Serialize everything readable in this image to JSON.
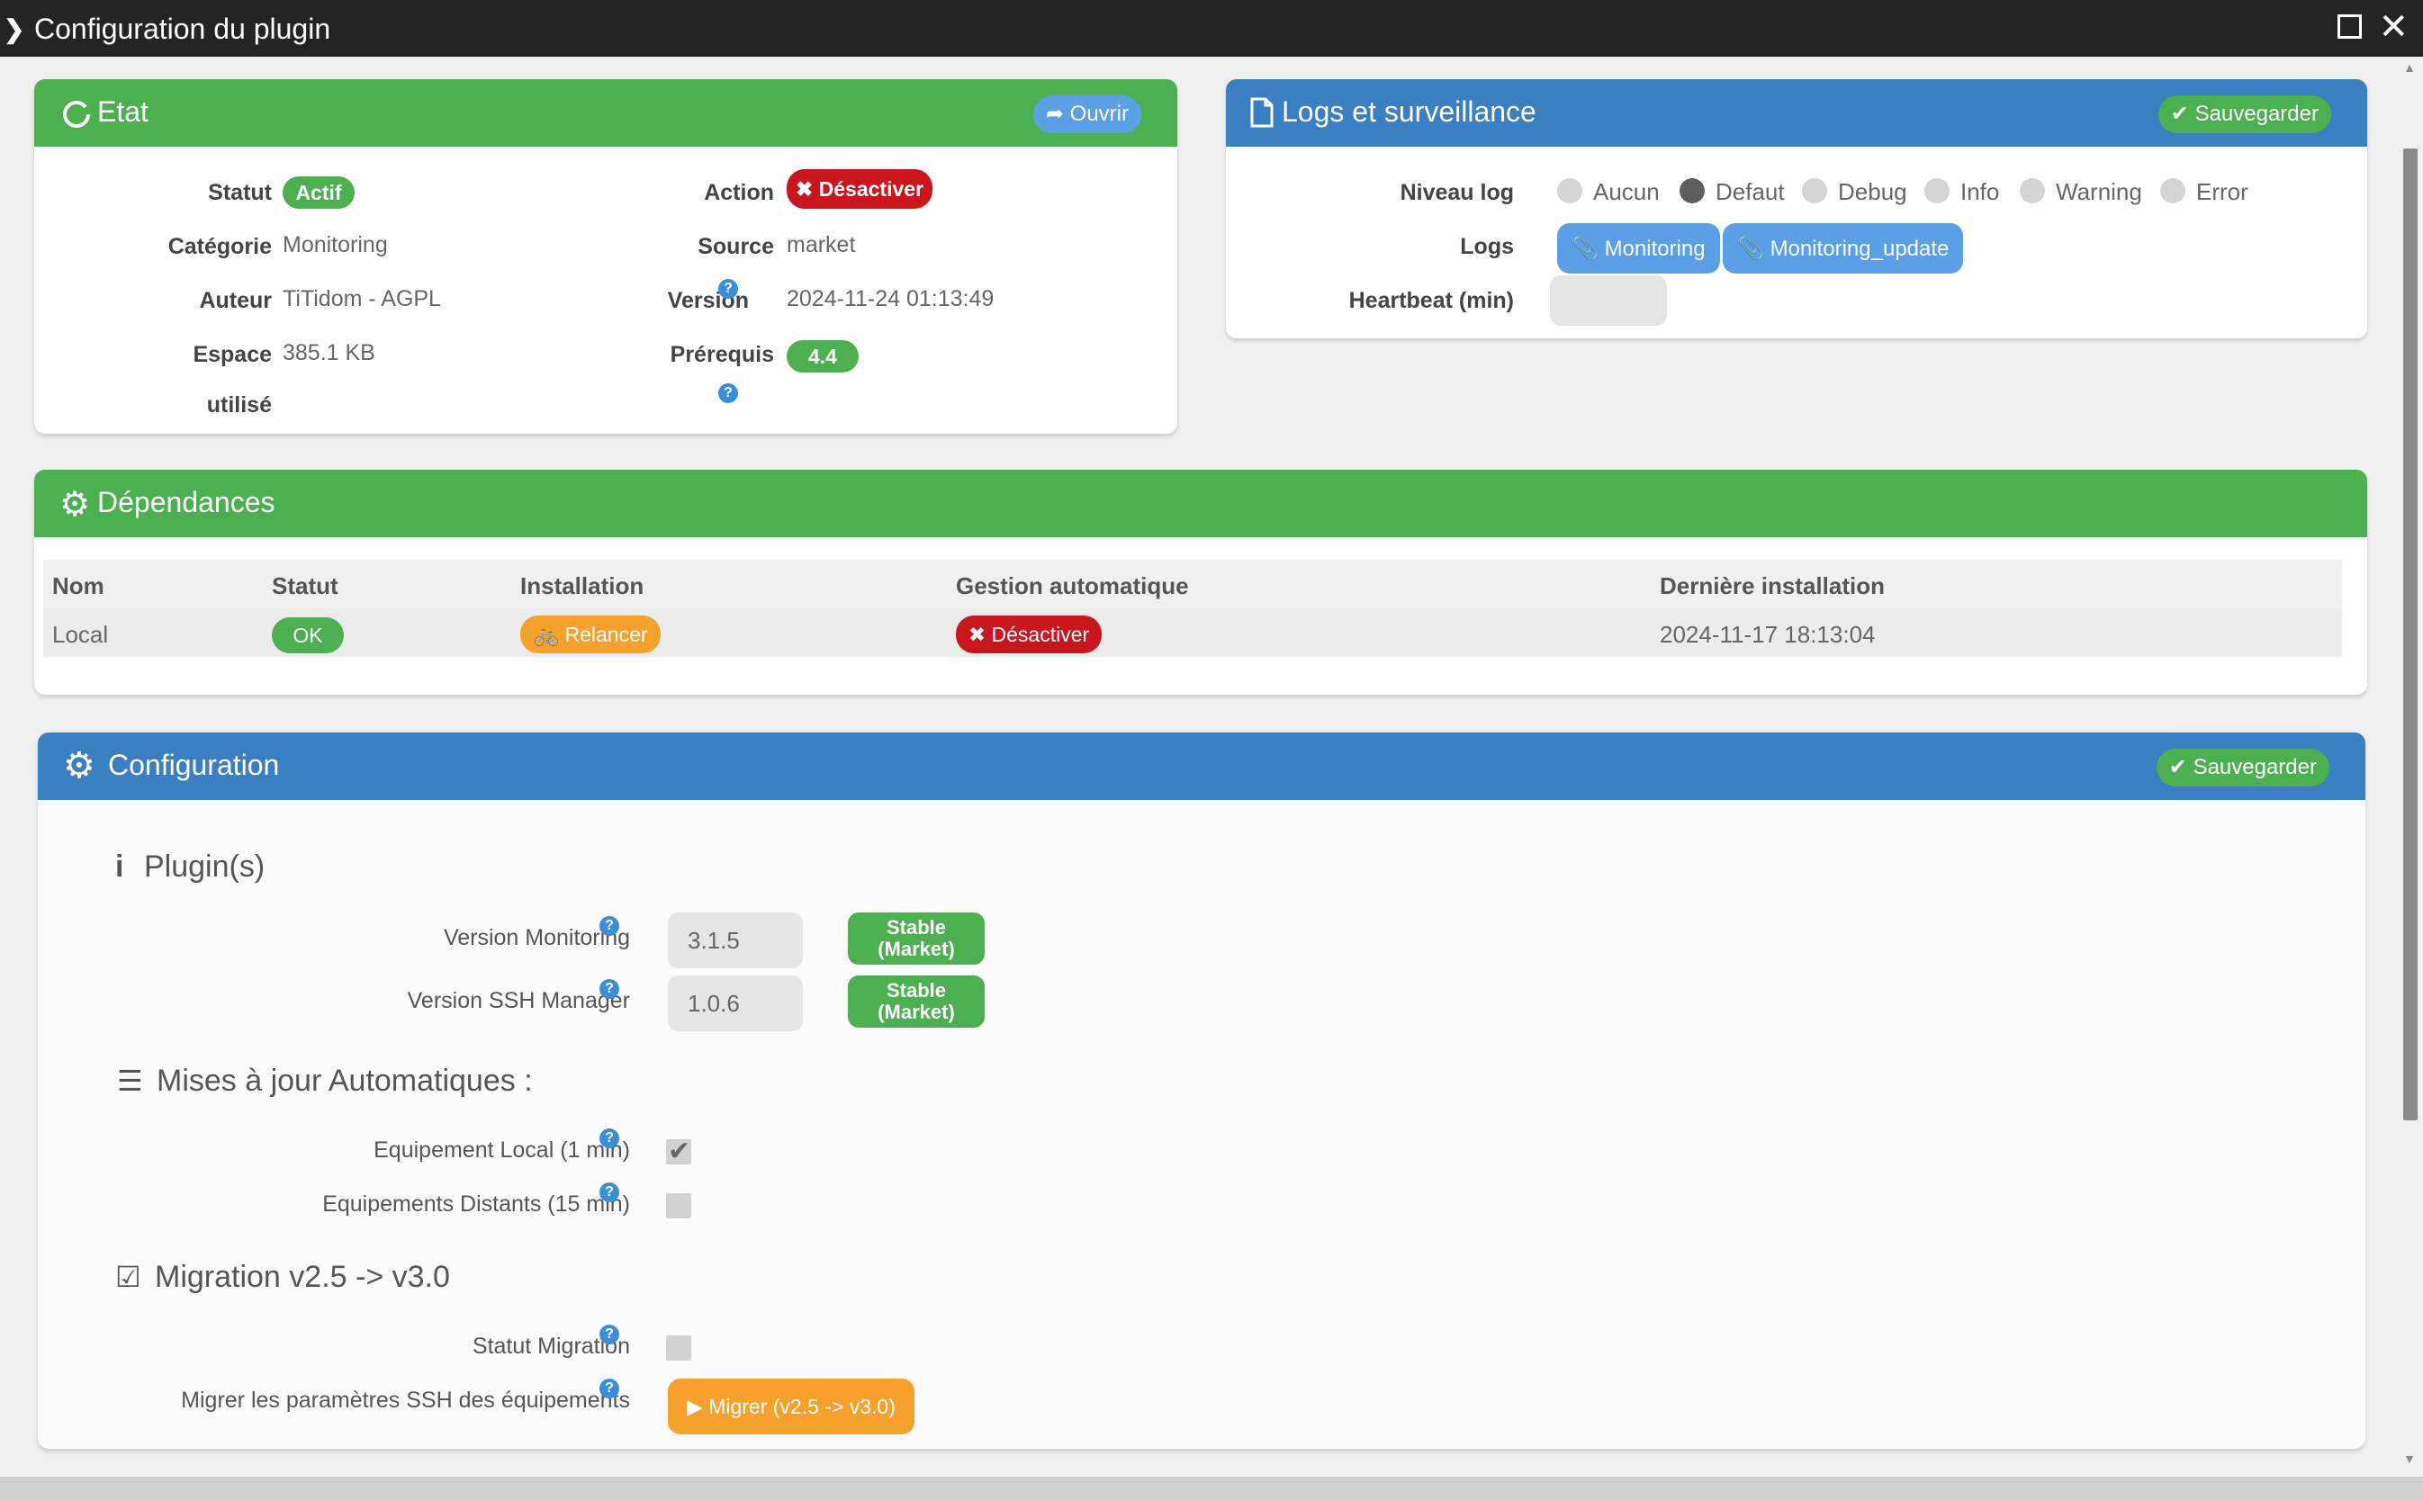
{
  "window": {
    "title": "Configuration du plugin"
  },
  "etat": {
    "title": "Etat",
    "open_label": "Ouvrir",
    "statut_label": "Statut",
    "statut_value": "Actif",
    "categorie_label": "Catégorie",
    "categorie_value": "Monitoring",
    "auteur_label": "Auteur",
    "auteur_value": "TiTidom - AGPL",
    "espace_label_1": "Espace",
    "espace_label_2": "utilisé",
    "espace_value": "385.1 KB",
    "action_label": "Action",
    "action_button": "Désactiver",
    "source_label": "Source",
    "source_value": "market",
    "version_label": "Version",
    "version_value": "2024-11-24 01:13:49",
    "prerequis_label": "Prérequis",
    "prerequis_value": "4.4"
  },
  "logs": {
    "title": "Logs et surveillance",
    "save_label": "Sauvegarder",
    "niveau_label": "Niveau log",
    "levels": [
      {
        "label": "Aucun",
        "selected": false
      },
      {
        "label": "Defaut",
        "selected": true
      },
      {
        "label": "Debug",
        "selected": false
      },
      {
        "label": "Info",
        "selected": false
      },
      {
        "label": "Warning",
        "selected": false
      },
      {
        "label": "Error",
        "selected": false
      }
    ],
    "logs_label": "Logs",
    "log_files": [
      "Monitoring",
      "Monitoring_update"
    ],
    "heartbeat_label": "Heartbeat (min)",
    "heartbeat_value": ""
  },
  "dependances": {
    "title": "Dépendances",
    "columns": [
      "Nom",
      "Statut",
      "Installation",
      "Gestion automatique",
      "Dernière installation"
    ],
    "row": {
      "nom": "Local",
      "statut": "OK",
      "installation": "Relancer",
      "gestion": "Désactiver",
      "derniere": "2024-11-17 18:13:04"
    }
  },
  "configuration": {
    "title": "Configuration",
    "save_label": "Sauvegarder",
    "plugins_section": "Plugin(s)",
    "version_monitoring_label": "Version Monitoring",
    "version_monitoring_value": "3.1.5",
    "version_ssh_label": "Version SSH Manager",
    "version_ssh_value": "1.0.6",
    "stable_line1": "Stable",
    "stable_line2": "(Market)",
    "maj_section": "Mises à jour Automatiques :",
    "equip_local_label": "Equipement Local (1 min)",
    "equip_local_checked": true,
    "equip_distants_label": "Equipements Distants (15 min)",
    "equip_distants_checked": false,
    "migration_section": "Migration v2.5 -> v3.0",
    "statut_migration_label": "Statut Migration",
    "statut_migration_checked": false,
    "migrer_label": "Migrer les paramètres SSH des équipements",
    "migrer_button": "Migrer (v2.5 -> v3.0)"
  },
  "colors": {
    "green": "#4caf50",
    "blue": "#3a7fc1",
    "red": "#c9161d",
    "orange": "#f5a12c",
    "light_blue": "#5b9fe6"
  }
}
